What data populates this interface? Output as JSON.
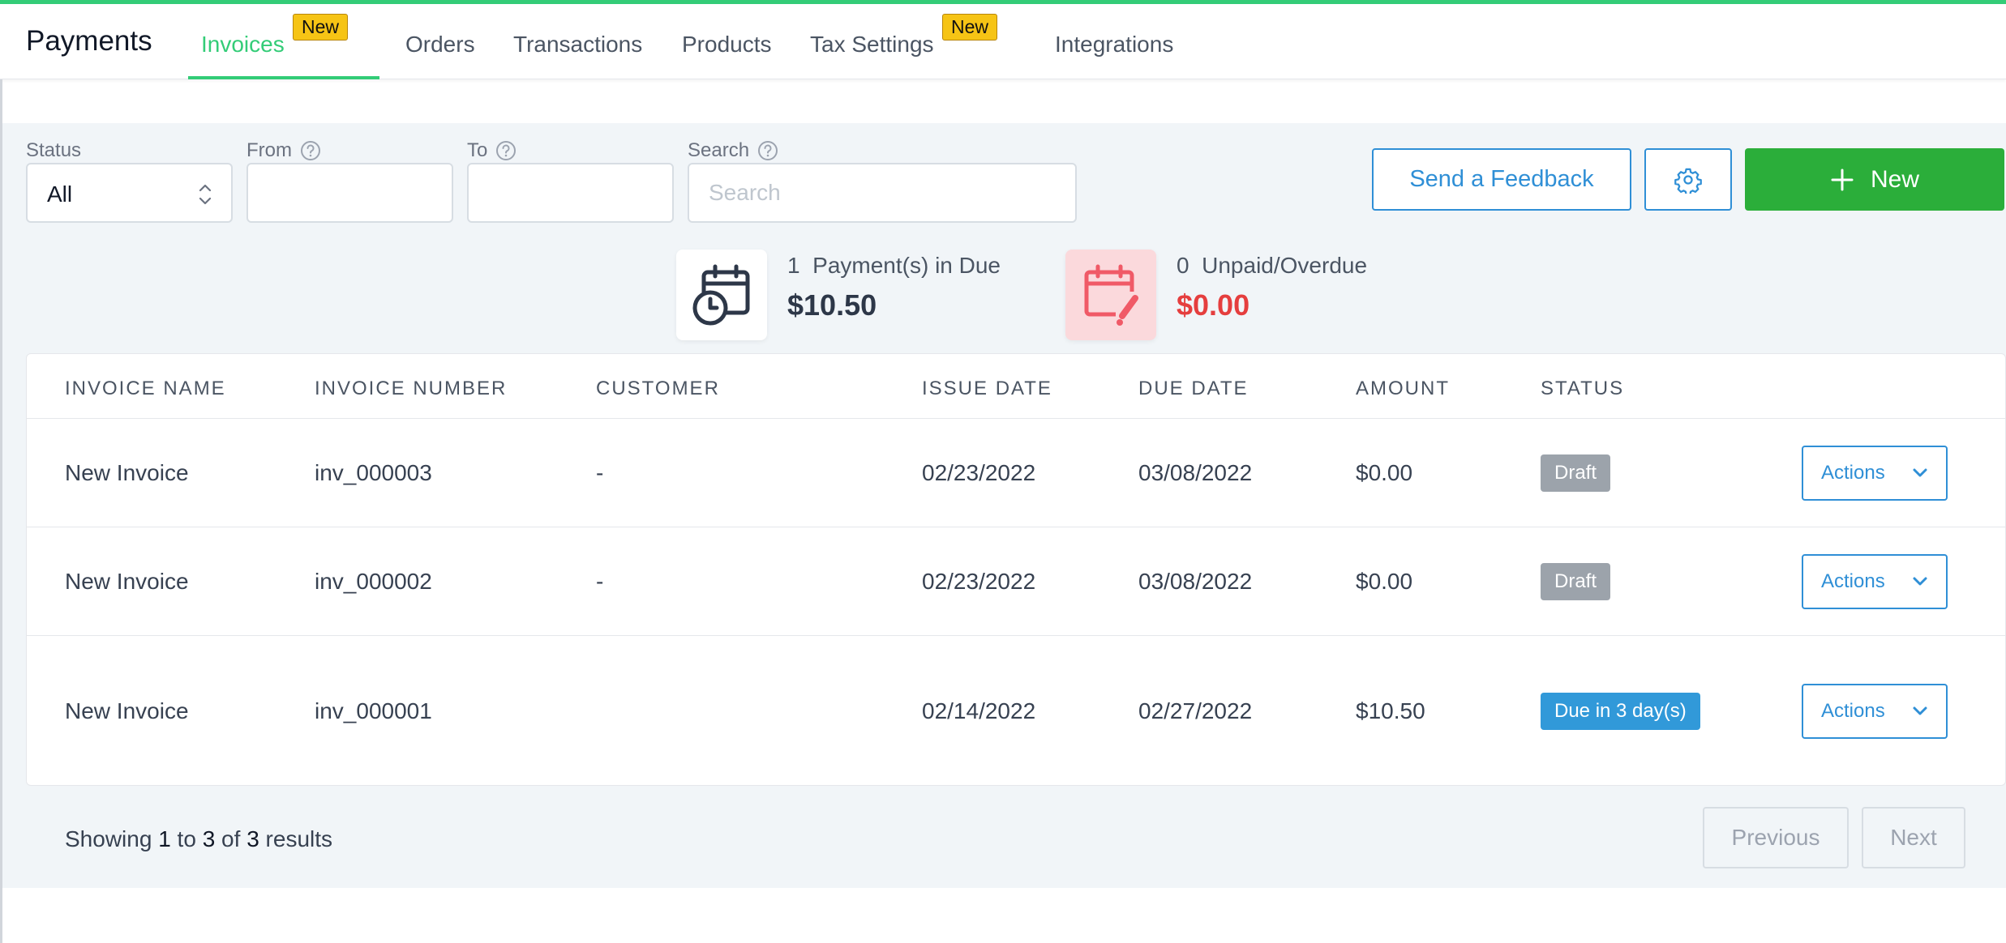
{
  "brand": "Payments",
  "nav": {
    "tabs": [
      {
        "label": "Invoices",
        "active": true,
        "badge": "New"
      },
      {
        "label": "Orders"
      },
      {
        "label": "Transactions"
      },
      {
        "label": "Products"
      },
      {
        "label": "Tax Settings",
        "badge": "New"
      },
      {
        "label": "Integrations"
      }
    ]
  },
  "filters": {
    "status_label": "Status",
    "status_value": "All",
    "from_label": "From",
    "to_label": "To",
    "search_label": "Search",
    "search_placeholder": "Search"
  },
  "buttons": {
    "feedback": "Send a Feedback",
    "new": "New"
  },
  "stats": {
    "due": {
      "count": "1",
      "label": "Payment(s) in Due",
      "amount": "$10.50"
    },
    "overdue": {
      "count": "0",
      "label": "Unpaid/Overdue",
      "amount": "$0.00"
    }
  },
  "table": {
    "columns": [
      "INVOICE NAME",
      "INVOICE NUMBER",
      "CUSTOMER",
      "ISSUE DATE",
      "DUE DATE",
      "AMOUNT",
      "STATUS"
    ],
    "rows": [
      {
        "name": "New Invoice",
        "number": "inv_000003",
        "customer": "-",
        "issue_date": "02/23/2022",
        "due_date": "03/08/2022",
        "amount": "$0.00",
        "status": "Draft",
        "action": "Actions"
      },
      {
        "name": "New Invoice",
        "number": "inv_000002",
        "customer": "-",
        "issue_date": "02/23/2022",
        "due_date": "03/08/2022",
        "amount": "$0.00",
        "status": "Draft",
        "action": "Actions"
      },
      {
        "name": "New Invoice",
        "number": "inv_000001",
        "customer": "",
        "issue_date": "02/14/2022",
        "due_date": "02/27/2022",
        "amount": "$10.50",
        "status": "Due in 3 day(s)",
        "action": "Actions"
      }
    ]
  },
  "pagination": {
    "showing_prefix": "Showing",
    "from": "1",
    "to_word": "to",
    "to": "3",
    "of_word": "of",
    "total": "3",
    "suffix": "results",
    "previous": "Previous",
    "next": "Next"
  },
  "colors": {
    "accent_green": "#33cc77",
    "primary_blue": "#2f8fd6",
    "new_button": "#2bae3a",
    "overdue_red": "#e53e3e",
    "draft_gray": "#9ca3ab",
    "due_blue": "#3199d9"
  },
  "icons": {
    "due": "calendar-clock-icon",
    "overdue": "calendar-edit-icon",
    "settings": "gear-icon",
    "add": "plus-icon",
    "help": "question-circle-icon",
    "select": "chevron-up-down-icon",
    "dropdown": "chevron-down-icon"
  }
}
